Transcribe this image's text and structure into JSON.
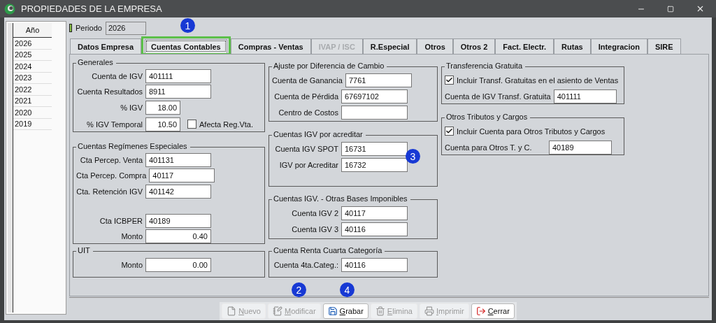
{
  "window": {
    "title": "PROPIEDADES DE LA EMPRESA"
  },
  "year_list": {
    "header": "Año",
    "rows": [
      "2026",
      "2025",
      "2024",
      "2023",
      "2022",
      "2021",
      "2020",
      "2019"
    ]
  },
  "periodo": {
    "label": "Periodo",
    "value": "2026"
  },
  "tabs": [
    {
      "label": "Datos Empresa",
      "selected": false,
      "disabled": false,
      "highlighted": false
    },
    {
      "label": "Cuentas Contables",
      "selected": true,
      "disabled": false,
      "highlighted": true
    },
    {
      "label": "Compras - Ventas",
      "selected": false,
      "disabled": false,
      "highlighted": false
    },
    {
      "label": "IVAP / ISC",
      "selected": false,
      "disabled": true,
      "highlighted": false
    },
    {
      "label": "R.Especial",
      "selected": false,
      "disabled": false,
      "highlighted": false
    },
    {
      "label": "Otros",
      "selected": false,
      "disabled": false,
      "highlighted": false
    },
    {
      "label": "Otros 2",
      "selected": false,
      "disabled": false,
      "highlighted": false
    },
    {
      "label": "Fact. Electr.",
      "selected": false,
      "disabled": false,
      "highlighted": false
    },
    {
      "label": "Rutas",
      "selected": false,
      "disabled": false,
      "highlighted": false
    },
    {
      "label": "Integracion",
      "selected": false,
      "disabled": false,
      "highlighted": false
    },
    {
      "label": "SIRE",
      "selected": false,
      "disabled": false,
      "highlighted": false
    }
  ],
  "columns": [
    [
      {
        "title": "Generales",
        "rows": [
          {
            "kind": "field",
            "label": "Cuenta de IGV",
            "value": "401111",
            "numeric": false
          },
          {
            "kind": "field",
            "label": "Cuenta Resultados",
            "value": "8911",
            "numeric": false
          },
          {
            "kind": "field",
            "label": "% IGV",
            "value": "18.00",
            "numeric": true
          },
          {
            "kind": "field",
            "label": "% IGV Temporal",
            "value": "10.50",
            "numeric": true,
            "checkbox": {
              "label": "Afecta Reg.Vta.",
              "checked": false
            }
          }
        ]
      },
      {
        "title": "Cuentas Regímenes Especiales",
        "rows": [
          {
            "kind": "field",
            "label": "Cta Percep. Venta",
            "value": "401131",
            "numeric": false
          },
          {
            "kind": "field",
            "label": "Cta Percep. Compra",
            "value": "40117",
            "numeric": false
          },
          {
            "kind": "field",
            "label": "Cta. Retención IGV",
            "value": "401142",
            "numeric": false
          },
          {
            "kind": "field",
            "label": "Cta ICBPER",
            "value": "40189",
            "numeric": false
          },
          {
            "kind": "field",
            "label": "Monto",
            "value": "0.40",
            "numeric": true
          }
        ]
      },
      {
        "title": "UIT",
        "rows": [
          {
            "kind": "field",
            "label": "Monto",
            "value": "0.00",
            "numeric": true
          }
        ]
      }
    ],
    [
      {
        "title": "Ajuste por Diferencia de Cambio",
        "rows": [
          {
            "kind": "field",
            "label": "Cuenta de Ganancia",
            "value": "7761",
            "numeric": false
          },
          {
            "kind": "field",
            "label": "Cuenta de Pérdida",
            "value": "67697102",
            "numeric": false
          },
          {
            "kind": "field",
            "label": "Centro de Costos",
            "value": ""
          }
        ]
      },
      {
        "title": "Cuentas IGV por acreditar",
        "rows": [
          {
            "kind": "field",
            "label": "Cuenta IGV SPOT",
            "value": "16731",
            "numeric": false
          },
          {
            "kind": "field",
            "label": "IGV por Acreditar",
            "value": "16732",
            "numeric": false
          }
        ]
      },
      {
        "title": "Cuentas IGV. - Otras Bases Imponibles",
        "rows": [
          {
            "kind": "field",
            "label": "Cuenta IGV 2",
            "value": "40117",
            "numeric": false
          },
          {
            "kind": "field",
            "label": "Cuenta IGV 3",
            "value": "40116",
            "numeric": false
          }
        ]
      },
      {
        "title": "Cuenta Renta Cuarta Categoría",
        "rows": [
          {
            "kind": "field",
            "label": "Cuenta 4ta.Categ.:",
            "value": "40116",
            "numeric": false
          }
        ]
      }
    ],
    [
      {
        "title": "Transferencia Gratuita",
        "rows": [
          {
            "kind": "check",
            "label": "Incluir Transf. Gratuitas en el asiento de Ventas",
            "checked": true
          },
          {
            "kind": "field",
            "label": "Cuenta de IGV Transf. Gratuita",
            "value": "401111",
            "numeric": false
          }
        ]
      },
      {
        "title": "Otros Tributos y Cargos",
        "rows": [
          {
            "kind": "check",
            "label": "Incluir Cuenta para Otros Tributos y Cargos",
            "checked": true
          },
          {
            "kind": "field",
            "label": "Cuenta para Otros T. y C.",
            "value": "40189",
            "numeric": false
          }
        ]
      }
    ]
  ],
  "buttons": [
    {
      "kind": "new",
      "label": "Nuevo",
      "disabled": true
    },
    {
      "kind": "edit",
      "label": "Modificar",
      "disabled": true
    },
    {
      "kind": "save",
      "label": "Grabar",
      "disabled": false
    },
    {
      "kind": "delete",
      "label": "Elimina",
      "disabled": true
    },
    {
      "kind": "print",
      "label": "Imprimir",
      "disabled": true
    },
    {
      "kind": "close",
      "label": "Cerrar",
      "disabled": false
    }
  ],
  "annotations": [
    {
      "label": "1"
    },
    {
      "label": "2"
    },
    {
      "label": "3"
    },
    {
      "label": "4"
    }
  ]
}
